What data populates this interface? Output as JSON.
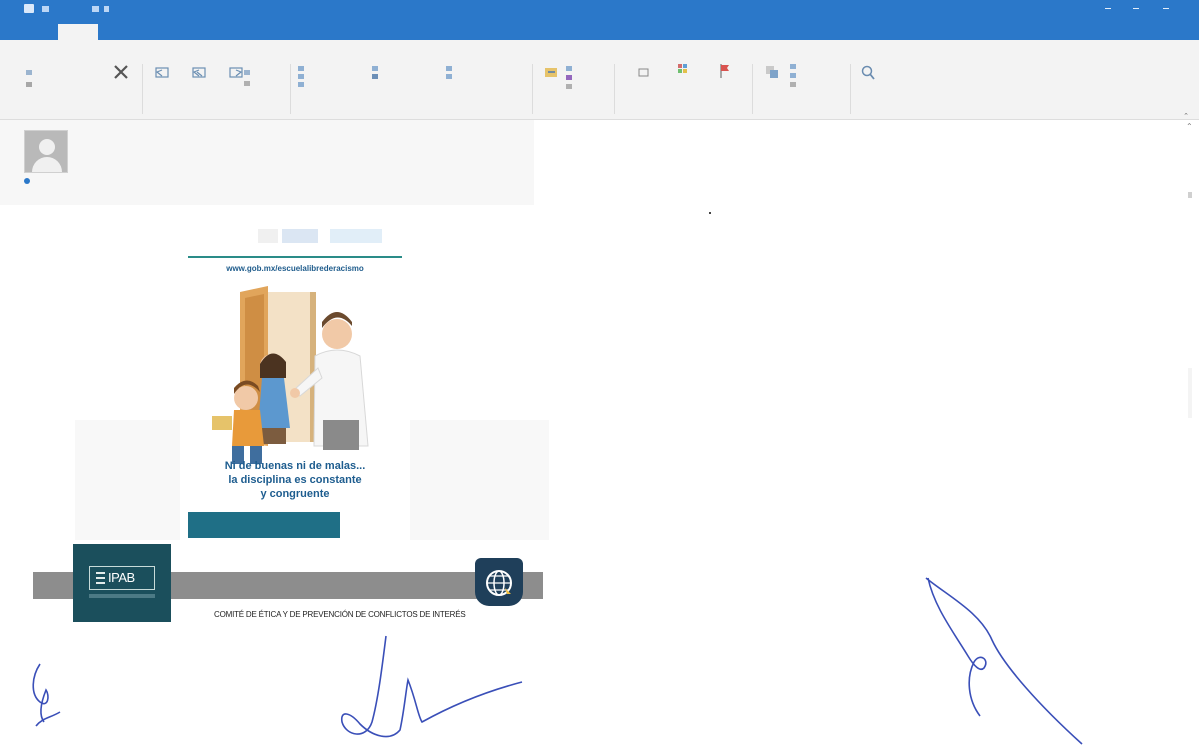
{
  "colors": {
    "title_bar": "#2b78c9",
    "ribbon_bg": "#f3f3f3",
    "subject": "#5a8fc2",
    "poster_teal": "#2a8c88",
    "poster_headline": "#1e5d8f",
    "ipab_dark": "#1b4f5c",
    "signature_ink": "#3a4fb8"
  },
  "footer": {
    "ipab_logo_text": "IPAB",
    "committee_caption": "COMITÉ DE ÉTICA Y DE PREVENCIÓN DE CONFLICTOS DE INTERÉS"
  },
  "poster": {
    "url": "www.gob.mx/escuelalibrederacismo",
    "headline": [
      "Ni de buenas ni de malas...",
      "la disciplina es constante",
      "y congruente"
    ]
  },
  "icons": [
    "app-icon",
    "delete-icon",
    "reply-icon",
    "reply-all-icon",
    "forward-icon",
    "move-icon",
    "tag-icon",
    "flag-icon",
    "translate-icon",
    "zoom-icon",
    "info-icon",
    "globe-icon"
  ]
}
